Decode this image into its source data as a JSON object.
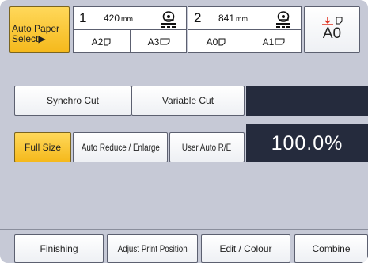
{
  "paper": {
    "auto_select_label_1": "Auto Paper",
    "auto_select_label_2": "Select▶",
    "trays": [
      {
        "number": "1",
        "length": "420",
        "unit": "mm",
        "sizes": [
          "A2",
          "A3"
        ]
      },
      {
        "number": "2",
        "length": "841",
        "unit": "mm",
        "sizes": [
          "A0",
          "A1"
        ]
      }
    ],
    "bypass_size": "A0"
  },
  "cut": {
    "synchro_label": "Synchro Cut",
    "variable_label": "Variable Cut",
    "variable_more": "..."
  },
  "reduce": {
    "full_size_label": "Full Size",
    "auto_reduce_label": "Auto Reduce / Enlarge",
    "user_auto_label": "User Auto R/E",
    "ratio": "100.0%"
  },
  "tabs": {
    "finishing": "Finishing",
    "adjust": "Adjust Print Position",
    "edit": "Edit / Colour",
    "combine": "Combine"
  },
  "colors": {
    "selected": "#f5b91c",
    "panel": "#c6c9d6",
    "display": "#252b3d"
  }
}
